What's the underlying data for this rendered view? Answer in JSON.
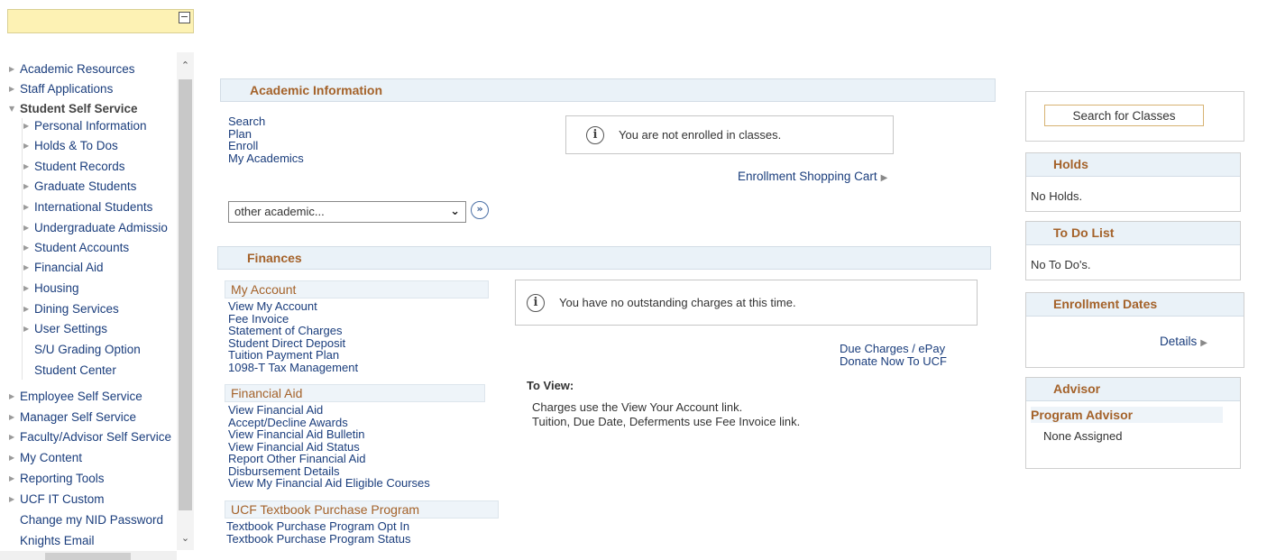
{
  "nav": {
    "items": [
      {
        "label": "Academic Resources",
        "level": 0,
        "state": "closed"
      },
      {
        "label": "Staff Applications",
        "level": 0,
        "state": "closed"
      },
      {
        "label": "Student Self Service",
        "level": 0,
        "state": "open"
      },
      {
        "label": "Personal Information",
        "level": 1,
        "state": "closed"
      },
      {
        "label": "Holds & To Dos",
        "level": 1,
        "state": "closed"
      },
      {
        "label": "Student Records",
        "level": 1,
        "state": "closed"
      },
      {
        "label": "Graduate Students",
        "level": 1,
        "state": "closed"
      },
      {
        "label": "International Students",
        "level": 1,
        "state": "closed"
      },
      {
        "label": "Undergraduate Admissio",
        "level": 1,
        "state": "closed"
      },
      {
        "label": "Student Accounts",
        "level": 1,
        "state": "closed"
      },
      {
        "label": "Financial Aid",
        "level": 1,
        "state": "closed"
      },
      {
        "label": "Housing",
        "level": 1,
        "state": "closed"
      },
      {
        "label": "Dining Services",
        "level": 1,
        "state": "closed"
      },
      {
        "label": "User Settings",
        "level": 1,
        "state": "closed"
      },
      {
        "label": "S/U Grading Option",
        "level": 1,
        "state": "leaf"
      },
      {
        "label": "Student Center",
        "level": 1,
        "state": "leaf"
      },
      {
        "label": "Employee Self Service",
        "level": 0,
        "state": "closed"
      },
      {
        "label": "Manager Self Service",
        "level": 0,
        "state": "closed"
      },
      {
        "label": "Faculty/Advisor Self Service",
        "level": 0,
        "state": "closed"
      },
      {
        "label": "My Content",
        "level": 0,
        "state": "closed"
      },
      {
        "label": "Reporting Tools",
        "level": 0,
        "state": "closed"
      },
      {
        "label": "UCF IT Custom",
        "level": 0,
        "state": "closed"
      },
      {
        "label": "Change my NID Password",
        "level": 0,
        "state": "leaf"
      },
      {
        "label": "Knights Email",
        "level": 0,
        "state": "leaf"
      }
    ]
  },
  "academic": {
    "title": "Academic Information",
    "links": [
      "Search",
      "Plan",
      "Enroll",
      "My Academics"
    ],
    "notice": "You are not enrolled in classes.",
    "cart_link": "Enrollment Shopping Cart",
    "select_value": "other academic..."
  },
  "finances": {
    "title": "Finances",
    "my_account": {
      "title": "My Account",
      "links": [
        "View My Account",
        "Fee Invoice",
        "Statement of Charges",
        "Student Direct Deposit",
        "Tuition Payment Plan",
        "1098-T Tax Management"
      ]
    },
    "financial_aid": {
      "title": "Financial Aid",
      "links": [
        "View Financial Aid",
        "Accept/Decline Awards",
        "View Financial Aid Bulletin",
        "View Financial Aid Status",
        "Report Other Financial Aid",
        "Disbursement Details",
        "View My Financial Aid Eligible Courses"
      ]
    },
    "textbook": {
      "title": "UCF Textbook Purchase Program",
      "links": [
        "Textbook Purchase Program Opt In",
        "Textbook Purchase Program Status"
      ]
    },
    "notice": "You have no outstanding charges at this time.",
    "due_link": "Due Charges / ePay",
    "donate_link": "Donate Now To UCF",
    "to_view_title": "To View:",
    "to_view_lines": [
      "Charges use the View Your Account link.",
      "Tuition, Due Date, Deferments use Fee Invoice link."
    ]
  },
  "right": {
    "search_button": "Search for Classes",
    "holds": {
      "title": "Holds",
      "text": "No Holds."
    },
    "todo": {
      "title": "To Do List",
      "text": "No To Do's."
    },
    "enrollment": {
      "title": "Enrollment Dates",
      "link": "Details"
    },
    "advisor": {
      "title": "Advisor",
      "subtitle": "Program Advisor",
      "text": "None Assigned"
    }
  },
  "icons": {
    "collapse": "minus-box-icon",
    "info": "info-circle-icon",
    "go": "double-chevron-right-icon",
    "arrow": "triangle-right-icon"
  },
  "colors": {
    "header_text": "#a4622a",
    "link": "#1a3d7c",
    "section_bg": "#eaf2f8",
    "nav_top_bg": "#fdf2b4"
  }
}
